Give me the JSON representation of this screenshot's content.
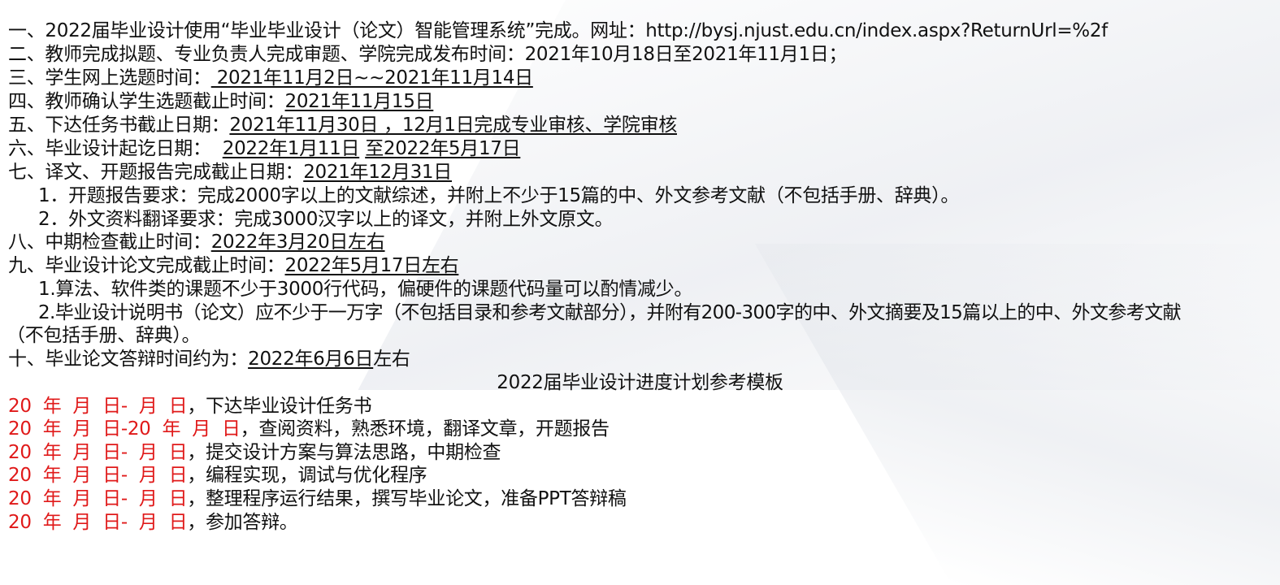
{
  "items": {
    "l1": {
      "text": "一、2022届毕业设计使用“毕业毕业设计（论文）智能管理系统”完成。网址：http://bysj.njust.edu.cn/index.aspx?ReturnUrl=%2f"
    },
    "l2": {
      "text": "二、教师完成拟题、专业负责人完成审题、学院完成发布时间：2021年10月18日至2021年11月1日；"
    },
    "l3": {
      "label": "三、学生网上选题时间：",
      "value": " 2021年11月2日~~2021年11月14日"
    },
    "l4": {
      "label": "四、教师确认学生选题截止时间：",
      "value": "2021年11月15日"
    },
    "l5": {
      "label": "五、下达任务书截止日期：",
      "value": "2021年11月30日 ，12月1日完成专业审核、学院审核"
    },
    "l6": {
      "label": "六、毕业设计起讫日期：  ",
      "value1": "2022年1月11日",
      "mid": " ",
      "value2": "至2022年5月17日"
    },
    "l7": {
      "label": "七、译文、开题报告完成截止日期：",
      "value": "2021年12月31日"
    },
    "l7_1": "1．开题报告要求：完成2000字以上的文献综述，并附上不少于15篇的中、外文参考文献（不包括手册、辞典）。",
    "l7_2": "2．外文资料翻译要求：完成3000汉字以上的译文，并附上外文原文。",
    "l8": {
      "label": "八、中期检查截止时间：",
      "value": "2022年3月20日左右"
    },
    "l9": {
      "label": "九、毕业设计论文完成截止时间：",
      "value": "2022年5月17日左右"
    },
    "l9_1": "1.算法、软件类的课题不少于3000行代码，偏硬件的课题代码量可以酌情减少。",
    "l9_2": "2.毕业设计说明书（论文）应不少于一万字（不包括目录和参考文献部分），并附有200-300字的中、外文摘要及15篇以上的中、外文参考文献",
    "l9_3": "（不包括手册、辞典）。",
    "l10": {
      "label": "十、毕业论文答辩时间约为：",
      "value": "2022年6月6日",
      "suffix": "左右"
    }
  },
  "template_title": "2022届毕业设计进度计划参考模板",
  "plan": [
    {
      "date": "20  年  月  日-  月  日",
      "task": "，下达毕业设计任务书"
    },
    {
      "date": "20  年  月  日-20  年  月  日",
      "task": "，查阅资料，熟悉环境，翻译文章，开题报告"
    },
    {
      "date": "20  年  月  日-  月  日",
      "task": "，提交设计方案与算法思路，中期检查"
    },
    {
      "date": "20  年  月  日-  月  日",
      "task": "，编程实现，调试与优化程序"
    },
    {
      "date": "20  年  月  日-  月  日",
      "task": "，整理程序运行结果，撰写毕业论文，准备PPT答辩稿"
    },
    {
      "date": "20  年  月  日-  月  日",
      "task": "，参加答辩。"
    }
  ],
  "colors": {
    "red": "#e01919",
    "text": "#111111"
  }
}
